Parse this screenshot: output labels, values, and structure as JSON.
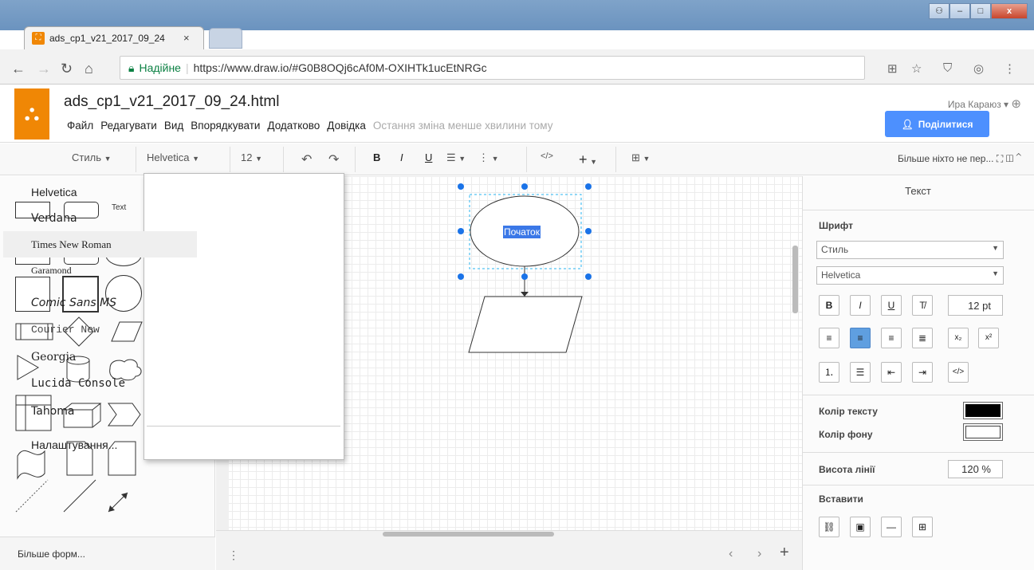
{
  "browser": {
    "tab_title": "ads_cp1_v21_2017_09_24",
    "tab_close": "×",
    "secure_label": "Надійне",
    "url": "https://www.draw.io/#G0B8OQj6cAf0M-OXIHTk1ucEtNRGc",
    "win_min": "–",
    "win_max": "□",
    "win_close": "x"
  },
  "app": {
    "doc_title": "ads_cp1_v21_2017_09_24.html",
    "menu": [
      "Файл",
      "Редагувати",
      "Вид",
      "Впорядкувати",
      "Додатково",
      "Довідка"
    ],
    "last_change": "Остання зміна менше хвилини тому",
    "user": "Ира Караюз ▾",
    "share_label": "Поділитися"
  },
  "toolbar": {
    "style": "Стиль",
    "font": "Helvetica",
    "size": "12",
    "bold": "B",
    "italic": "I",
    "underline": "U",
    "code": "</>",
    "right_text": "Більше ніхто не пер..."
  },
  "sidebar": {
    "text_shape": "Text",
    "more_shapes": "Більше форм..."
  },
  "canvas": {
    "start_label": "Початок"
  },
  "dropdown": {
    "fonts": [
      "Helvetica",
      "Verdana",
      "Times New Roman",
      "Garamond",
      "Comic Sans MS",
      "Courier New",
      "Georgia",
      "Lucida Console",
      "Tahoma"
    ],
    "highlighted": "Times New Roman",
    "settings": "Налаштування..."
  },
  "right_panel": {
    "tab": "Текст",
    "font_heading": "Шрифт",
    "style_select": "Стиль",
    "font_select": "Helvetica",
    "font_size": "12 pt",
    "text_color_label": "Колір тексту",
    "bg_color_label": "Колір фону",
    "line_height_label": "Висота лінії",
    "line_height": "120 %",
    "insert_label": "Вставити",
    "text_color": "#000000",
    "bg_color": "#ffffff"
  },
  "colors": {
    "accent": "#f08705",
    "share": "#4d90fe",
    "selection": "#29b6f2"
  }
}
